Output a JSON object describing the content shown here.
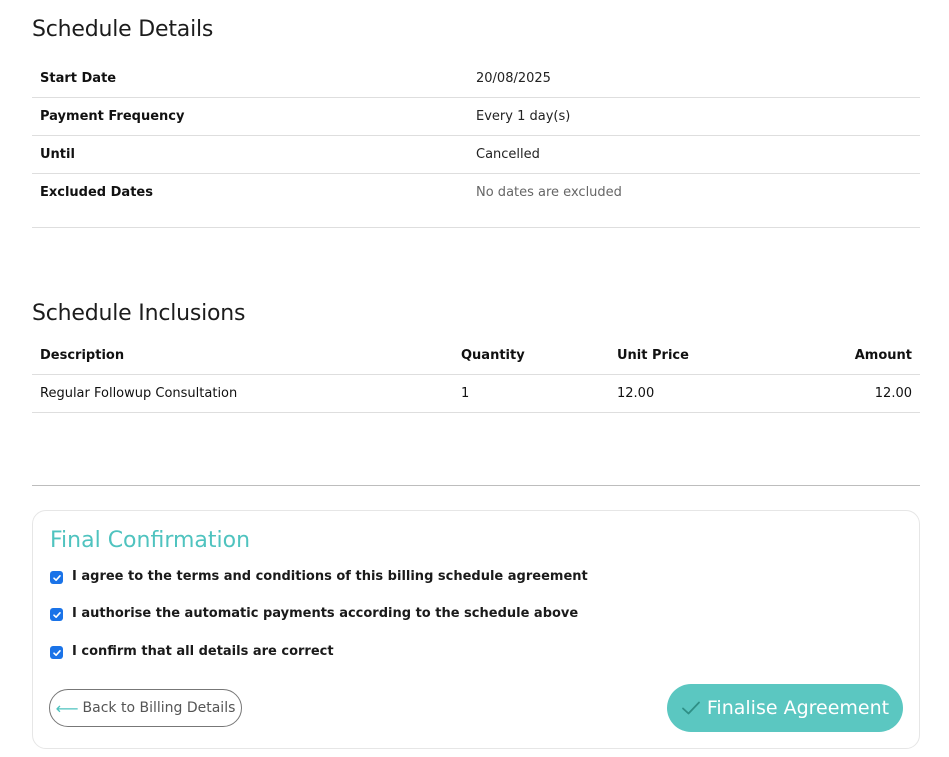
{
  "schedule_details": {
    "title": "Schedule Details",
    "rows": [
      {
        "label": "Start Date",
        "value": "20/08/2025"
      },
      {
        "label": "Payment Frequency",
        "value": "Every 1 day(s)"
      },
      {
        "label": "Until",
        "value": "Cancelled"
      },
      {
        "label": "Excluded Dates",
        "value": "No dates are excluded"
      }
    ]
  },
  "schedule_inclusions": {
    "title": "Schedule Inclusions",
    "columns": [
      "Description",
      "Quantity",
      "Unit Price",
      "Amount"
    ],
    "rows": [
      {
        "description": "Regular Followup Consultation",
        "quantity": "1",
        "unit_price": "12.00",
        "amount": "12.00"
      }
    ]
  },
  "final_confirmation": {
    "title": "Final Confirmation",
    "checkboxes": [
      {
        "label": "I agree to the terms and conditions of this billing schedule agreement",
        "checked": true
      },
      {
        "label": "I authorise the automatic payments according to the schedule above",
        "checked": true
      },
      {
        "label": "I confirm that all details are correct",
        "checked": true
      }
    ],
    "back_button": {
      "arrow": "⟵",
      "label": "Back to Billing Details"
    },
    "finalise_button": {
      "label": "Finalise Agreement",
      "icon": "check-icon"
    }
  },
  "colors": {
    "accent": "#5bc7c1",
    "accent_text": "#4fc3bf",
    "checkbox": "#1a73e8"
  }
}
